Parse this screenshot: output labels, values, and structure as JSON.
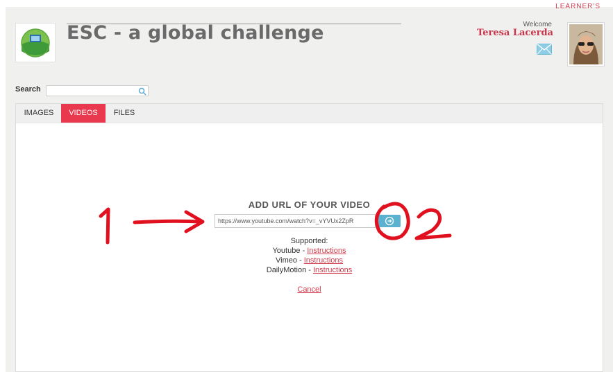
{
  "header": {
    "top_cut_text": "LEARNER'S",
    "title": "ESC - a global challenge",
    "welcome": "Welcome",
    "username": "Teresa Lacerda"
  },
  "search": {
    "label": "Search",
    "value": ""
  },
  "tabs": [
    {
      "label": "IMAGES",
      "active": false
    },
    {
      "label": "VIDEOS",
      "active": true
    },
    {
      "label": "FILES",
      "active": false
    }
  ],
  "video": {
    "heading": "ADD URL OF YOUR VIDEO",
    "url_value": "https://www.youtube.com/watch?v=_vYVUx2ZpR",
    "supported_label": "Supported:",
    "providers": [
      {
        "name": "Youtube",
        "link": "Instructions"
      },
      {
        "name": "Vimeo",
        "link": "Instructions"
      },
      {
        "name": "DailyMotion",
        "link": "Instructions"
      }
    ],
    "cancel": "Cancel"
  },
  "annotations": {
    "marker_one": "1",
    "marker_two": "2",
    "color": "#e0101e"
  },
  "colors": {
    "accent": "#e8394f",
    "link": "#d23b4e",
    "button": "#5bb2d0"
  }
}
